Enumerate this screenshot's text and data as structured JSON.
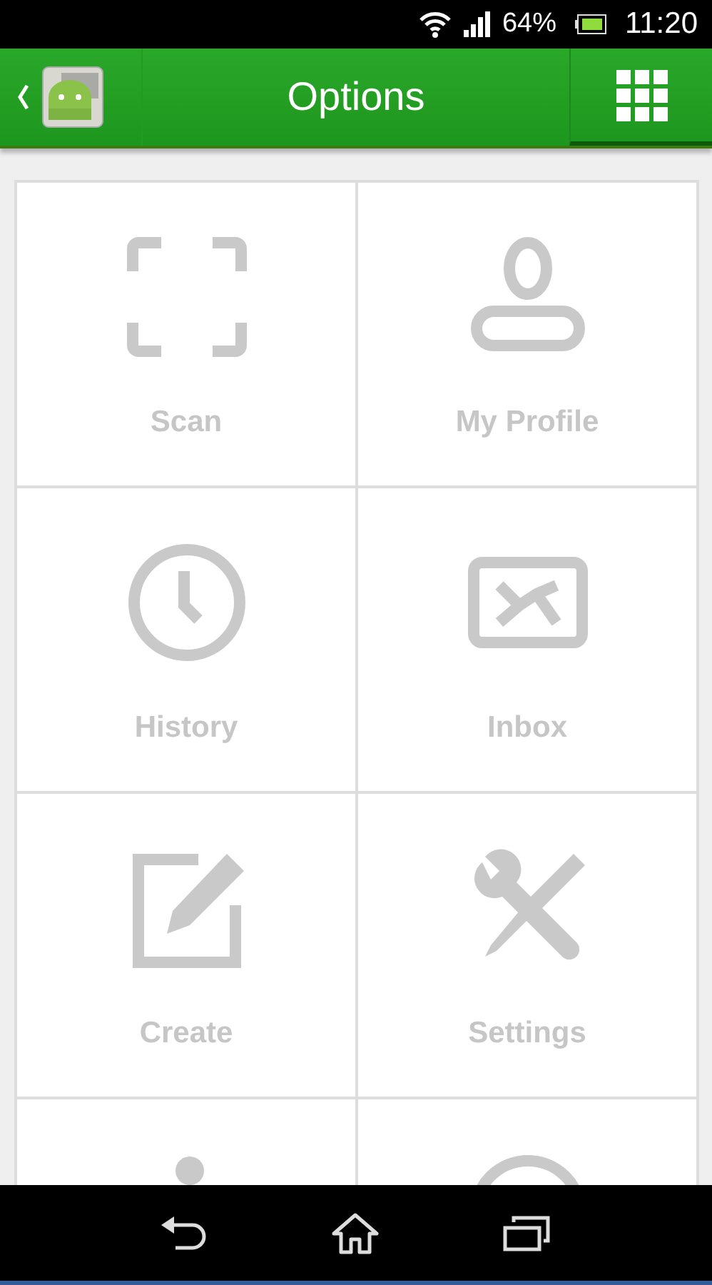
{
  "status_bar": {
    "battery": "64%",
    "time": "11:20"
  },
  "action_bar": {
    "title": "Options"
  },
  "tiles": [
    {
      "kind": "scan",
      "label": "Scan"
    },
    {
      "kind": "profile",
      "label": "My Profile"
    },
    {
      "kind": "history",
      "label": "History"
    },
    {
      "kind": "inbox",
      "label": "Inbox"
    },
    {
      "kind": "create",
      "label": "Create"
    },
    {
      "kind": "settings",
      "label": "Settings"
    },
    {
      "kind": "person"
    },
    {
      "kind": "circle"
    }
  ]
}
